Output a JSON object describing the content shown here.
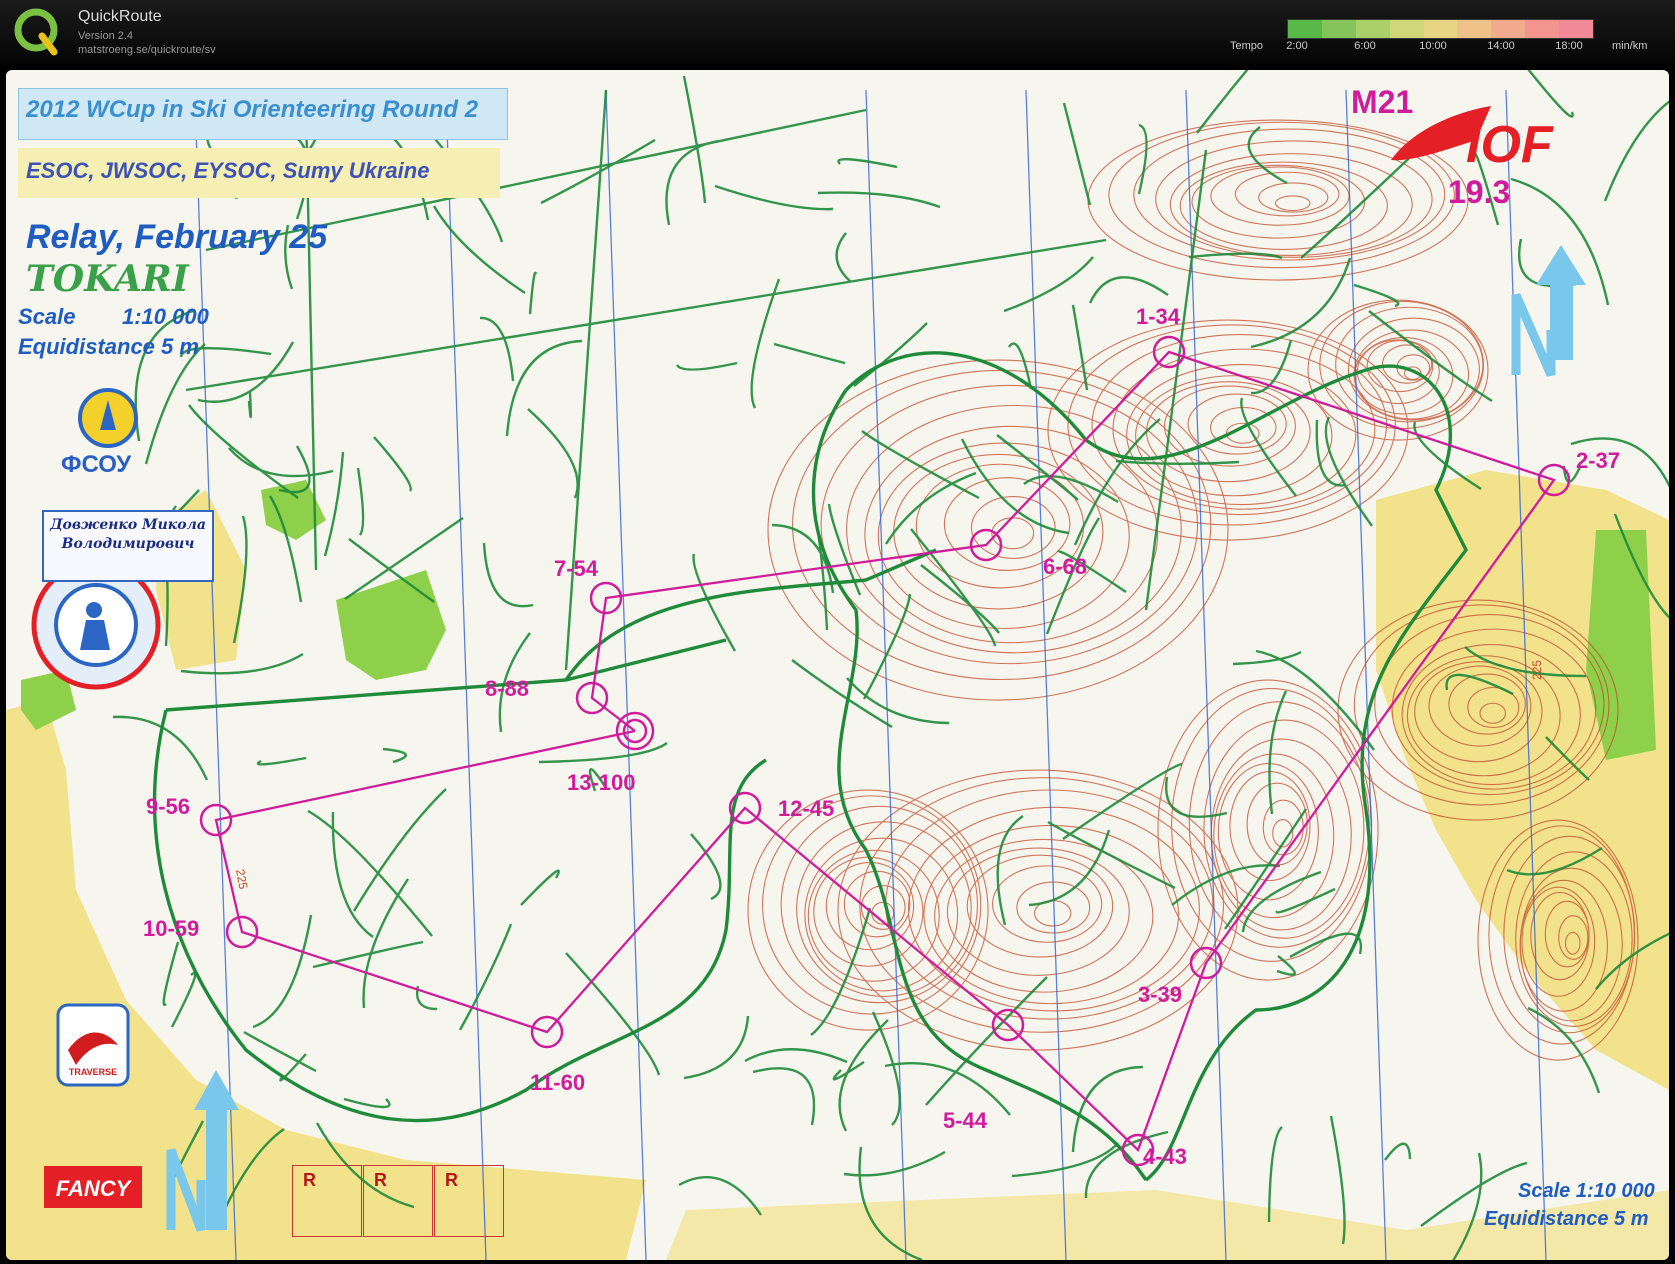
{
  "app": {
    "title": "QuickRoute",
    "version": "Version 2.4",
    "url": "matstroeng.se/quickroute/sv"
  },
  "tempo_legend": {
    "label": "Tempo",
    "ticks": [
      "2:00",
      "6:00",
      "10:00",
      "14:00",
      "18:00"
    ],
    "unit": "min/km",
    "gradient": [
      "#58b848",
      "#84c45a",
      "#abd06a",
      "#cfd778",
      "#e7d484",
      "#efc28a",
      "#f2aa8e",
      "#f3948f",
      "#f18a96"
    ]
  },
  "map": {
    "title": "2012 WCup in Ski Orienteering Round 2",
    "events": "ESOC, JWSOC, EYSOC, Sumy Ukraine",
    "race": "Relay, February 25",
    "area": "TOKARI",
    "scale_label": "Scale",
    "scale_value": "1:10 000",
    "equidistance": "Equidistance  5 m",
    "class": "M21",
    "distance": "19.3",
    "scale_bottom": "Scale  1:10 000",
    "equidistance_bottom": "Equidistance  5 m",
    "federation": "ФСОУ",
    "person_name": "Довженко Микола Володимирович",
    "sponsor1": "TRAVERSE",
    "sponsor2": "FANCY",
    "iof_logo": "IOF",
    "contour_label": "225",
    "r_boxes": [
      "R",
      "R",
      "R"
    ]
  },
  "controls": [
    {
      "label": "1-34"
    },
    {
      "label": "2-37"
    },
    {
      "label": "3-39"
    },
    {
      "label": "4-43"
    },
    {
      "label": "5-44"
    },
    {
      "label": "6-68"
    },
    {
      "label": "7-54"
    },
    {
      "label": "8-88"
    },
    {
      "label": "9-56"
    },
    {
      "label": "10-59"
    },
    {
      "label": "11-60"
    },
    {
      "label": "12-45"
    },
    {
      "label": "13-100"
    }
  ],
  "colors": {
    "course": "#d01c9c",
    "track": "#1e8a3a",
    "contour": "#c2492a",
    "water": "#2f63d8",
    "open_land": "#f2e28c",
    "route": "#2e7d32"
  }
}
